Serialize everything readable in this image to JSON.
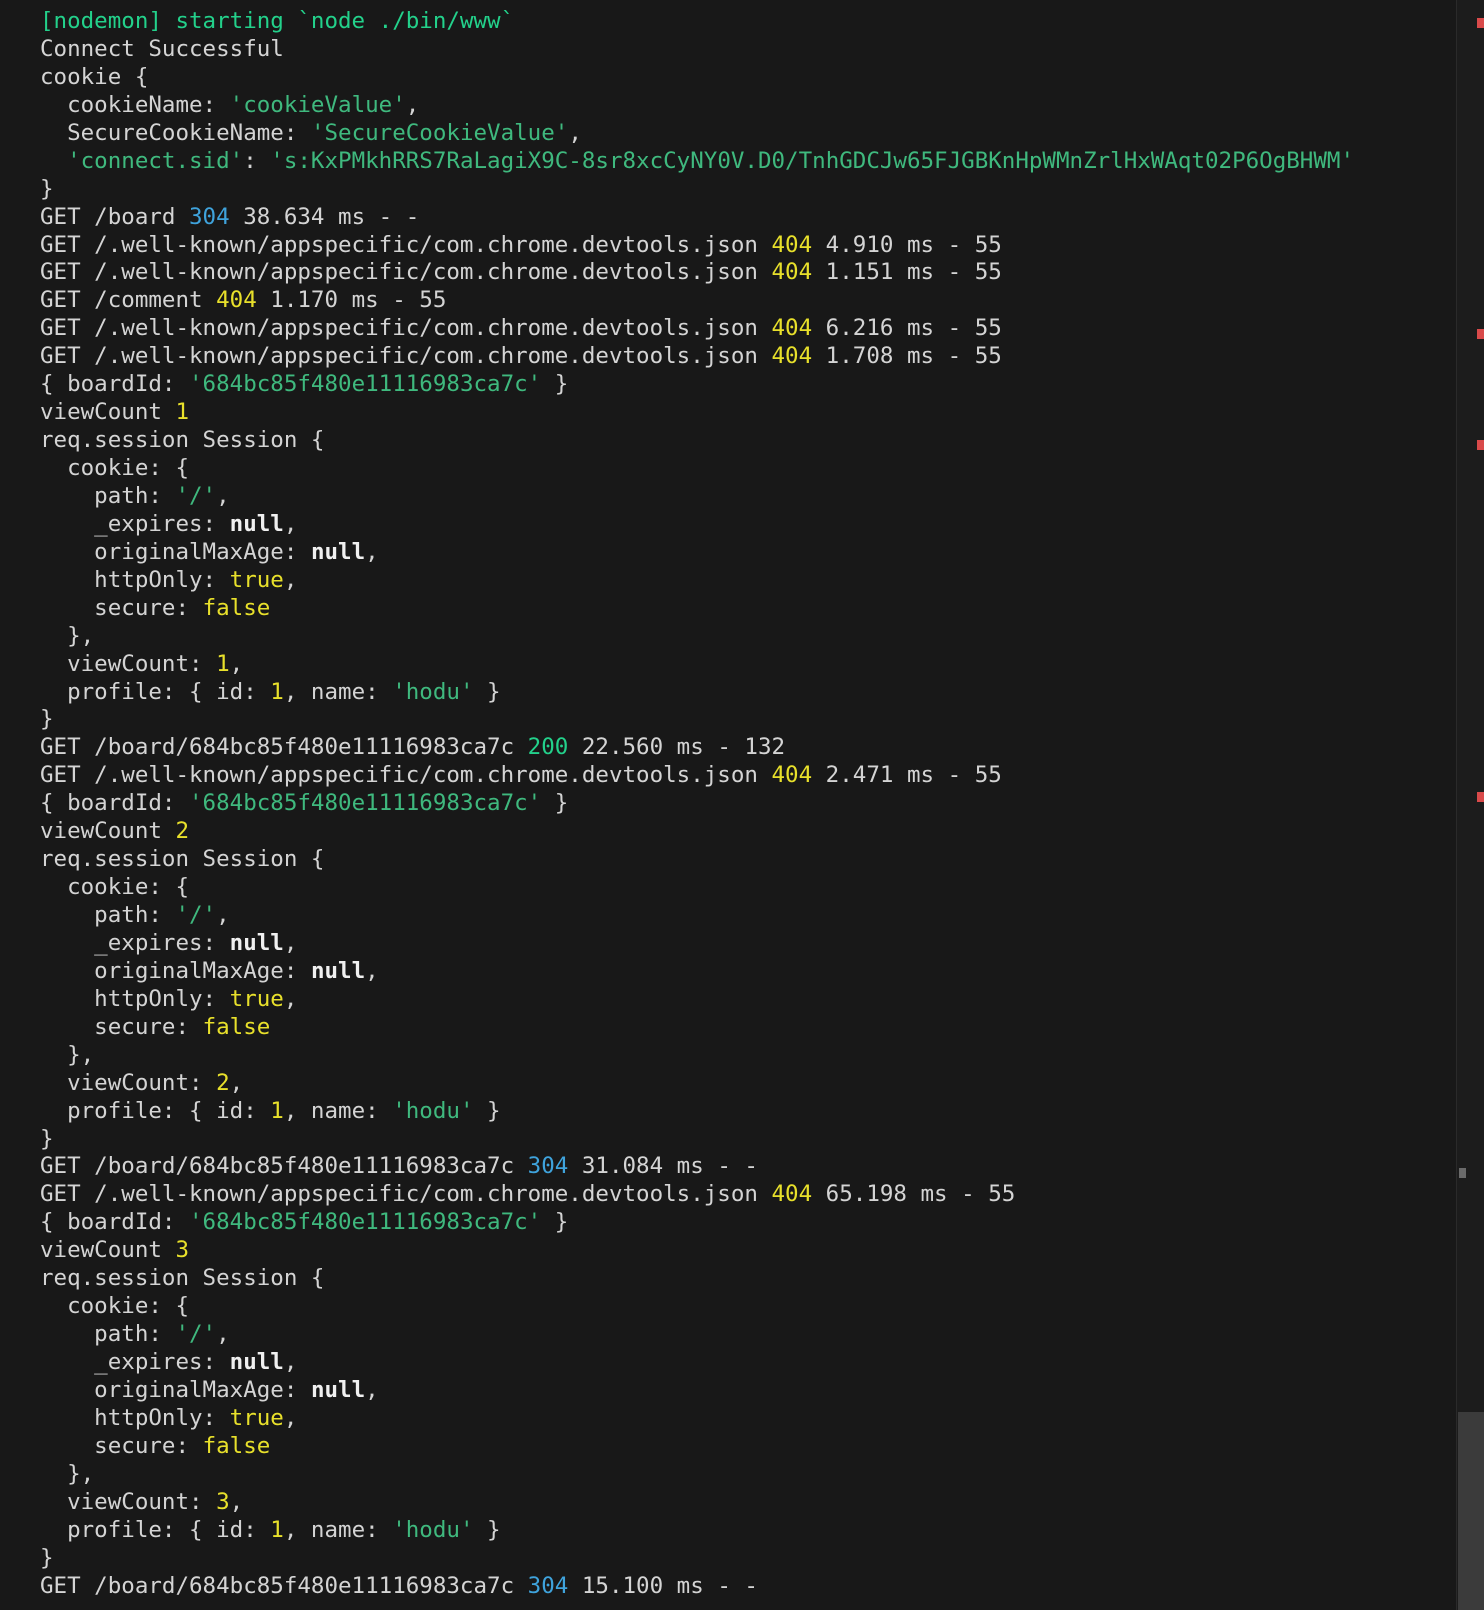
{
  "terminal": {
    "lines": [
      [
        {
          "t": "[nodemon] starting `node ./bin/www`",
          "c": "g"
        }
      ],
      [
        {
          "t": "Connect Successful",
          "c": "d"
        }
      ],
      [
        {
          "t": "cookie {",
          "c": "d"
        }
      ],
      [
        {
          "t": "  cookieName: ",
          "c": "d"
        },
        {
          "t": "'cookieValue'",
          "c": "s"
        },
        {
          "t": ",",
          "c": "d"
        }
      ],
      [
        {
          "t": "  SecureCookieName: ",
          "c": "d"
        },
        {
          "t": "'SecureCookieValue'",
          "c": "s"
        },
        {
          "t": ",",
          "c": "d"
        }
      ],
      [
        {
          "t": "  ",
          "c": "d"
        },
        {
          "t": "'connect.sid'",
          "c": "s"
        },
        {
          "t": ": ",
          "c": "d"
        },
        {
          "t": "'s:KxPMkhRRS7RaLagiX9C-8sr8xcCyNY0V.D0/TnhGDCJw65FJGBKnHpWMnZrlHxWAqt02P6OgBHWM'",
          "c": "s"
        }
      ],
      [
        {
          "t": "}",
          "c": "d"
        }
      ],
      [
        {
          "t": "GET /board ",
          "c": "d"
        },
        {
          "t": "304",
          "c": "b"
        },
        {
          "t": " 38.634 ms - -",
          "c": "d"
        }
      ],
      [
        {
          "t": "GET /.well-known/appspecific/com.chrome.devtools.json ",
          "c": "d"
        },
        {
          "t": "404",
          "c": "y"
        },
        {
          "t": " 4.910 ms - 55",
          "c": "d"
        }
      ],
      [
        {
          "t": "GET /.well-known/appspecific/com.chrome.devtools.json ",
          "c": "d"
        },
        {
          "t": "404",
          "c": "y"
        },
        {
          "t": " 1.151 ms - 55",
          "c": "d"
        }
      ],
      [
        {
          "t": "GET /comment ",
          "c": "d"
        },
        {
          "t": "404",
          "c": "y"
        },
        {
          "t": " 1.170 ms - 55",
          "c": "d"
        }
      ],
      [
        {
          "t": "GET /.well-known/appspecific/com.chrome.devtools.json ",
          "c": "d"
        },
        {
          "t": "404",
          "c": "y"
        },
        {
          "t": " 6.216 ms - 55",
          "c": "d"
        }
      ],
      [
        {
          "t": "GET /.well-known/appspecific/com.chrome.devtools.json ",
          "c": "d"
        },
        {
          "t": "404",
          "c": "y"
        },
        {
          "t": " 1.708 ms - 55",
          "c": "d"
        }
      ],
      [
        {
          "t": "{ boardId: ",
          "c": "d"
        },
        {
          "t": "'684bc85f480e11116983ca7c'",
          "c": "s"
        },
        {
          "t": " }",
          "c": "d"
        }
      ],
      [
        {
          "t": "viewCount ",
          "c": "d"
        },
        {
          "t": "1",
          "c": "y"
        }
      ],
      [
        {
          "t": "req.session Session {",
          "c": "d"
        }
      ],
      [
        {
          "t": "  cookie: {",
          "c": "d"
        }
      ],
      [
        {
          "t": "    path: ",
          "c": "d"
        },
        {
          "t": "'/'",
          "c": "s"
        },
        {
          "t": ",",
          "c": "d"
        }
      ],
      [
        {
          "t": "    _expires: ",
          "c": "d"
        },
        {
          "t": "null",
          "c": "w"
        },
        {
          "t": ",",
          "c": "d"
        }
      ],
      [
        {
          "t": "    originalMaxAge: ",
          "c": "d"
        },
        {
          "t": "null",
          "c": "w"
        },
        {
          "t": ",",
          "c": "d"
        }
      ],
      [
        {
          "t": "    httpOnly: ",
          "c": "d"
        },
        {
          "t": "true",
          "c": "y"
        },
        {
          "t": ",",
          "c": "d"
        }
      ],
      [
        {
          "t": "    secure: ",
          "c": "d"
        },
        {
          "t": "false",
          "c": "y"
        }
      ],
      [
        {
          "t": "  },",
          "c": "d"
        }
      ],
      [
        {
          "t": "  viewCount: ",
          "c": "d"
        },
        {
          "t": "1",
          "c": "y"
        },
        {
          "t": ",",
          "c": "d"
        }
      ],
      [
        {
          "t": "  profile: { id: ",
          "c": "d"
        },
        {
          "t": "1",
          "c": "y"
        },
        {
          "t": ", name: ",
          "c": "d"
        },
        {
          "t": "'hodu'",
          "c": "s"
        },
        {
          "t": " }",
          "c": "d"
        }
      ],
      [
        {
          "t": "}",
          "c": "d"
        }
      ],
      [
        {
          "t": "GET /board/684bc85f480e11116983ca7c ",
          "c": "d"
        },
        {
          "t": "200",
          "c": "g"
        },
        {
          "t": " 22.560 ms - 132",
          "c": "d"
        }
      ],
      [
        {
          "t": "GET /.well-known/appspecific/com.chrome.devtools.json ",
          "c": "d"
        },
        {
          "t": "404",
          "c": "y"
        },
        {
          "t": " 2.471 ms - 55",
          "c": "d"
        }
      ],
      [
        {
          "t": "{ boardId: ",
          "c": "d"
        },
        {
          "t": "'684bc85f480e11116983ca7c'",
          "c": "s"
        },
        {
          "t": " }",
          "c": "d"
        }
      ],
      [
        {
          "t": "viewCount ",
          "c": "d"
        },
        {
          "t": "2",
          "c": "y"
        }
      ],
      [
        {
          "t": "req.session Session {",
          "c": "d"
        }
      ],
      [
        {
          "t": "  cookie: {",
          "c": "d"
        }
      ],
      [
        {
          "t": "    path: ",
          "c": "d"
        },
        {
          "t": "'/'",
          "c": "s"
        },
        {
          "t": ",",
          "c": "d"
        }
      ],
      [
        {
          "t": "    _expires: ",
          "c": "d"
        },
        {
          "t": "null",
          "c": "w"
        },
        {
          "t": ",",
          "c": "d"
        }
      ],
      [
        {
          "t": "    originalMaxAge: ",
          "c": "d"
        },
        {
          "t": "null",
          "c": "w"
        },
        {
          "t": ",",
          "c": "d"
        }
      ],
      [
        {
          "t": "    httpOnly: ",
          "c": "d"
        },
        {
          "t": "true",
          "c": "y"
        },
        {
          "t": ",",
          "c": "d"
        }
      ],
      [
        {
          "t": "    secure: ",
          "c": "d"
        },
        {
          "t": "false",
          "c": "y"
        }
      ],
      [
        {
          "t": "  },",
          "c": "d"
        }
      ],
      [
        {
          "t": "  viewCount: ",
          "c": "d"
        },
        {
          "t": "2",
          "c": "y"
        },
        {
          "t": ",",
          "c": "d"
        }
      ],
      [
        {
          "t": "  profile: { id: ",
          "c": "d"
        },
        {
          "t": "1",
          "c": "y"
        },
        {
          "t": ", name: ",
          "c": "d"
        },
        {
          "t": "'hodu'",
          "c": "s"
        },
        {
          "t": " }",
          "c": "d"
        }
      ],
      [
        {
          "t": "}",
          "c": "d"
        }
      ],
      [
        {
          "t": "GET /board/684bc85f480e11116983ca7c ",
          "c": "d"
        },
        {
          "t": "304",
          "c": "b"
        },
        {
          "t": " 31.084 ms - -",
          "c": "d"
        }
      ],
      [
        {
          "t": "GET /.well-known/appspecific/com.chrome.devtools.json ",
          "c": "d"
        },
        {
          "t": "404",
          "c": "y"
        },
        {
          "t": " 65.198 ms - 55",
          "c": "d"
        }
      ],
      [
        {
          "t": "{ boardId: ",
          "c": "d"
        },
        {
          "t": "'684bc85f480e11116983ca7c'",
          "c": "s"
        },
        {
          "t": " }",
          "c": "d"
        }
      ],
      [
        {
          "t": "viewCount ",
          "c": "d"
        },
        {
          "t": "3",
          "c": "y"
        }
      ],
      [
        {
          "t": "req.session Session {",
          "c": "d"
        }
      ],
      [
        {
          "t": "  cookie: {",
          "c": "d"
        }
      ],
      [
        {
          "t": "    path: ",
          "c": "d"
        },
        {
          "t": "'/'",
          "c": "s"
        },
        {
          "t": ",",
          "c": "d"
        }
      ],
      [
        {
          "t": "    _expires: ",
          "c": "d"
        },
        {
          "t": "null",
          "c": "w"
        },
        {
          "t": ",",
          "c": "d"
        }
      ],
      [
        {
          "t": "    originalMaxAge: ",
          "c": "d"
        },
        {
          "t": "null",
          "c": "w"
        },
        {
          "t": ",",
          "c": "d"
        }
      ],
      [
        {
          "t": "    httpOnly: ",
          "c": "d"
        },
        {
          "t": "true",
          "c": "y"
        },
        {
          "t": ",",
          "c": "d"
        }
      ],
      [
        {
          "t": "    secure: ",
          "c": "d"
        },
        {
          "t": "false",
          "c": "y"
        }
      ],
      [
        {
          "t": "  },",
          "c": "d"
        }
      ],
      [
        {
          "t": "  viewCount: ",
          "c": "d"
        },
        {
          "t": "3",
          "c": "y"
        },
        {
          "t": ",",
          "c": "d"
        }
      ],
      [
        {
          "t": "  profile: { id: ",
          "c": "d"
        },
        {
          "t": "1",
          "c": "y"
        },
        {
          "t": ", name: ",
          "c": "d"
        },
        {
          "t": "'hodu'",
          "c": "s"
        },
        {
          "t": " }",
          "c": "d"
        }
      ],
      [
        {
          "t": "}",
          "c": "d"
        }
      ],
      [
        {
          "t": "GET /board/684bc85f480e11116983ca7c ",
          "c": "d"
        },
        {
          "t": "304",
          "c": "b"
        },
        {
          "t": " 15.100 ms - -",
          "c": "d"
        }
      ]
    ]
  },
  "colors": {
    "background": "#181818",
    "default_text": "#d4d4d4",
    "nodemon_green": "#23d18b",
    "string_green": "#3fb97e",
    "number_yellow": "#e8e02b",
    "status_blue": "#3fa3dc",
    "null_white": "#f0f0f0",
    "scroll_marker_red": "#d94a4a"
  }
}
